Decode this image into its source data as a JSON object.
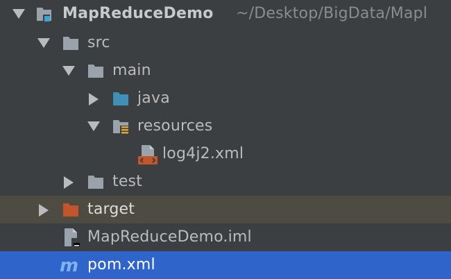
{
  "tree": {
    "project": {
      "name": "MapReduceDemo",
      "path": "~/Desktop/BigData/Mapl"
    },
    "src": "src",
    "main": "main",
    "java": "java",
    "resources": "resources",
    "log4j2": "log4j2.xml",
    "test": "test",
    "target": "target",
    "iml": "MapReduceDemo.iml",
    "pom": "pom.xml"
  },
  "colors": {
    "background": "#3c3f41",
    "selection": "#2f65ca",
    "target_highlight": "#4e4b42",
    "folder_gray": "#9aa3ab",
    "source_folder_blue": "#3f8fb6",
    "excluded_folder_orange": "#c2552a",
    "resource_bars": "#e0a533"
  },
  "icons": {
    "project": "project-module-icon",
    "folder": "folder-icon",
    "source_folder": "source-folder-icon",
    "resources_folder": "resources-folder-icon",
    "xml_file": "xml-file-icon",
    "excluded_folder": "excluded-folder-icon",
    "iml_file": "iml-file-icon",
    "maven": "maven-icon"
  }
}
